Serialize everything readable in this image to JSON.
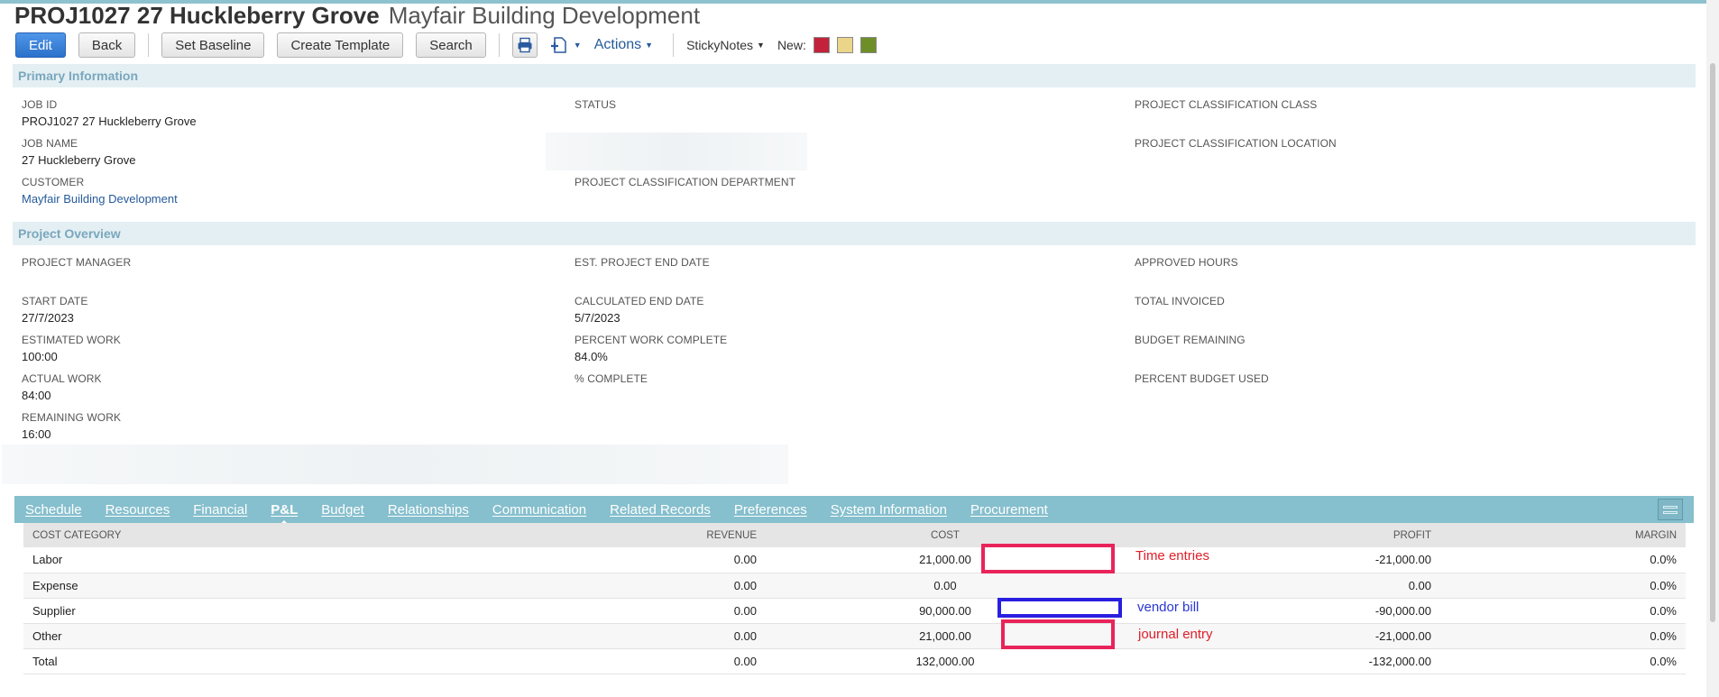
{
  "header": {
    "title": "PROJ1027 27 Huckleberry Grove",
    "subtitle": "Mayfair Building Development"
  },
  "toolbar": {
    "edit_label": "Edit",
    "back_label": "Back",
    "set_baseline_label": "Set Baseline",
    "create_template_label": "Create Template",
    "search_label": "Search",
    "print_icon": "printer-icon",
    "new_record_icon": "add-document-icon",
    "actions_label": "Actions",
    "sticky_notes_label": "StickyNotes",
    "new_label": "New:",
    "note_colors": [
      "#c4223a",
      "#ebd58a",
      "#6e8f28"
    ]
  },
  "primary": {
    "section_title": "Primary Information",
    "job_id_label": "JOB ID",
    "job_id": "PROJ1027 27 Huckleberry Grove",
    "job_name_label": "JOB NAME",
    "job_name": "27 Huckleberry Grove",
    "customer_label": "CUSTOMER",
    "customer": "Mayfair Building Development",
    "status_label": "STATUS",
    "dept_label": "PROJECT CLASSIFICATION DEPARTMENT",
    "class_label": "PROJECT CLASSIFICATION CLASS",
    "location_label": "PROJECT CLASSIFICATION LOCATION"
  },
  "overview": {
    "section_title": "Project Overview",
    "pm_label": "PROJECT MANAGER",
    "start_label": "START DATE",
    "start": "27/7/2023",
    "est_work_label": "ESTIMATED WORK",
    "est_work": "100:00",
    "actual_work_label": "ACTUAL WORK",
    "actual_work": "84:00",
    "remaining_work_label": "REMAINING WORK",
    "remaining_work": "16:00",
    "est_end_label": "EST. PROJECT END DATE",
    "calc_end_label": "CALCULATED END DATE",
    "calc_end": "5/7/2023",
    "pct_work_label": "PERCENT WORK COMPLETE",
    "pct_work": "84.0%",
    "pct_complete_label": "% COMPLETE",
    "approved_label": "APPROVED HOURS",
    "invoiced_label": "TOTAL INVOICED",
    "budget_rem_label": "BUDGET REMAINING",
    "budget_used_label": "PERCENT BUDGET USED"
  },
  "tabs": [
    "Schedule",
    "Resources",
    "Financial",
    "P&L",
    "Budget",
    "Relationships",
    "Communication",
    "Related Records",
    "Preferences",
    "System Information",
    "Procurement"
  ],
  "pl": {
    "columns": [
      "COST CATEGORY",
      "REVENUE",
      "COST",
      "PROFIT",
      "MARGIN"
    ],
    "rows": [
      [
        "Labor",
        "0.00",
        "21,000.00",
        "-21,000.00",
        "0.0%"
      ],
      [
        "Expense",
        "0.00",
        "0.00",
        "0.00",
        "0.0%"
      ],
      [
        "Supplier",
        "0.00",
        "90,000.00",
        "-90,000.00",
        "0.0%"
      ],
      [
        "Other",
        "0.00",
        "21,000.00",
        "-21,000.00",
        "0.0%"
      ],
      [
        "Total",
        "0.00",
        "132,000.00",
        "-132,000.00",
        "0.0%"
      ]
    ]
  },
  "annotations": {
    "time_entries": "Time entries",
    "vendor_bill": "vendor bill",
    "journal_entry": "journal entry",
    "red": "#e8245a",
    "blue": "#2a1fe0",
    "red_text": "#e0202a",
    "blue_text": "#2a36d4"
  }
}
